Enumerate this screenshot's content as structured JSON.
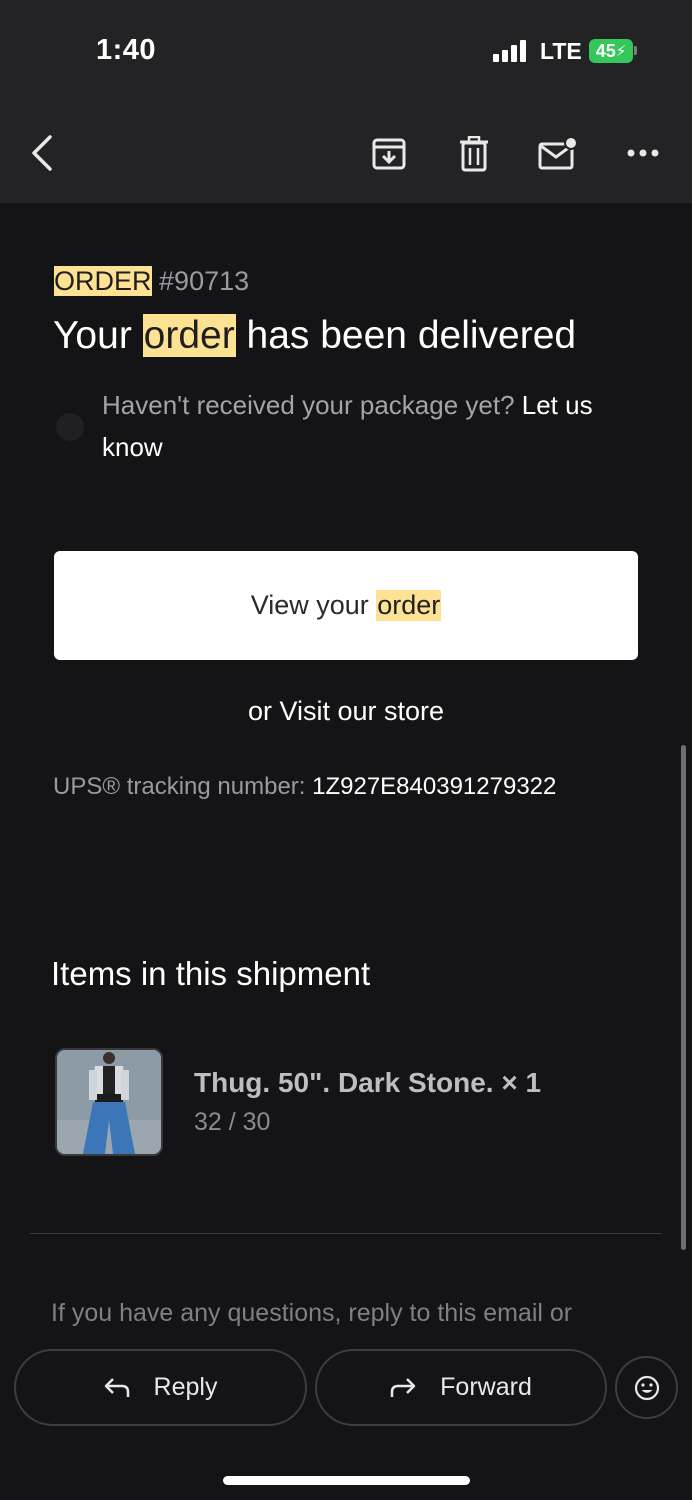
{
  "status_bar": {
    "time": "1:40",
    "network": "LTE",
    "battery": "45"
  },
  "toolbar": {
    "icons": [
      "back-arrow-icon",
      "archive-icon",
      "trash-icon",
      "mark-unread-icon",
      "more-icon"
    ]
  },
  "email": {
    "order_label": "ORDER",
    "order_number": "#90713",
    "headline_before": "Your ",
    "headline_highlight": "order",
    "headline_after": " has been delivered",
    "help_text": "Haven't received your package yet? ",
    "help_link": "Let us know",
    "view_button_prefix": "View your ",
    "view_button_highlight": "order",
    "visit_link": "or Visit our store",
    "tracking_label": "UPS® tracking number: ",
    "tracking_number": "1Z927E840391279322",
    "items_title": "Items in this shipment",
    "item": {
      "name": "Thug. 50\". Dark Stone. × 1",
      "variant": "32 / 30"
    },
    "footer_text": "If you have any questions, reply to this email or"
  },
  "actions": {
    "reply": "Reply",
    "forward": "Forward"
  },
  "colors": {
    "background": "#141416",
    "toolbar": "#232325",
    "highlight": "#fde293",
    "battery": "#34c759"
  }
}
